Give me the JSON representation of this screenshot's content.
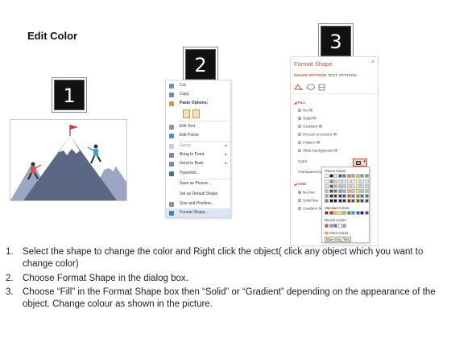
{
  "title": "Edit Color",
  "steps": {
    "one": "1",
    "two": "2",
    "three": "3"
  },
  "context_menu": {
    "items": [
      {
        "label": "Cut",
        "icon": "scissors-icon"
      },
      {
        "label": "Copy",
        "icon": "copy-icon"
      },
      {
        "label": "Paste Options:",
        "icon": "paste-icon"
      },
      {
        "label": "Edit Text",
        "icon": "edit-text-icon"
      },
      {
        "label": "Edit Points",
        "icon": "edit-points-icon"
      },
      {
        "label": "Group",
        "icon": "group-icon"
      },
      {
        "label": "Bring to Front",
        "icon": "bring-front-icon"
      },
      {
        "label": "Send to Back",
        "icon": "send-back-icon"
      },
      {
        "label": "Hyperlink...",
        "icon": "hyperlink-icon"
      },
      {
        "label": "Save as Picture...",
        "icon": ""
      },
      {
        "label": "Set as Default Shape",
        "icon": ""
      },
      {
        "label": "Size and Position...",
        "icon": "size-position-icon"
      },
      {
        "label": "Format Shape...",
        "icon": "format-shape-icon"
      }
    ]
  },
  "format_pane": {
    "title": "Format Shape",
    "close": "×",
    "tab_shape_options": "SHAPE OPTIONS",
    "tab_text_options": "TEXT OPTIONS",
    "fill_section": "FILL",
    "fill_options": [
      "No fill",
      "Solid fill",
      "Gradient fill",
      "Picture or texture fill",
      "Pattern fill",
      "Slide background fill"
    ],
    "color_label": "Color",
    "transparency_label": "Transparency",
    "line_section": "LINE",
    "line_options": [
      "No line",
      "Solid line",
      "Gradient line"
    ]
  },
  "palette": {
    "theme_colors": "Theme Colors",
    "standard_colors": "Standard Colors",
    "recent_colors": "Recent Colors",
    "more_colors": "More Colors...",
    "tooltip": "Blue-Gray",
    "tooltip_rest": "Text"
  },
  "instructions": [
    {
      "num": "1.",
      "text": "Select the shape to change the color and Right click the object( click any object which you want to change color)"
    },
    {
      "num": "2.",
      "text": "Choose Format Shape in the dialog box."
    },
    {
      "num": "3.",
      "text": "Choose “Fill” in the Format Shape box then “Solid” or “Gradient” depending on the appearance of the object. Change colour as shown in the picture."
    }
  ],
  "colors": {
    "accent": "#c5533a",
    "mountain_dark": "#5b6785",
    "mountain_light": "#9aa6c2",
    "snow": "#ffffff",
    "flag": "#d9342b",
    "climber_blue": "#3aa7c9",
    "climber_red": "#d9534f"
  }
}
